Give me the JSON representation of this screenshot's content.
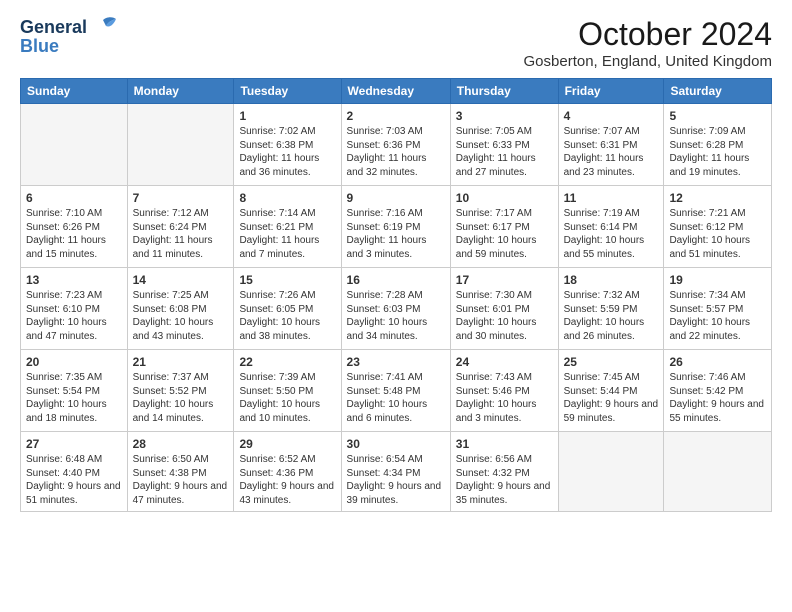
{
  "header": {
    "logo_line1": "General",
    "logo_line2": "Blue",
    "month_title": "October 2024",
    "location": "Gosberton, England, United Kingdom"
  },
  "days_of_week": [
    "Sunday",
    "Monday",
    "Tuesday",
    "Wednesday",
    "Thursday",
    "Friday",
    "Saturday"
  ],
  "weeks": [
    [
      {
        "day": "",
        "info": ""
      },
      {
        "day": "",
        "info": ""
      },
      {
        "day": "1",
        "info": "Sunrise: 7:02 AM\nSunset: 6:38 PM\nDaylight: 11 hours and 36 minutes."
      },
      {
        "day": "2",
        "info": "Sunrise: 7:03 AM\nSunset: 6:36 PM\nDaylight: 11 hours and 32 minutes."
      },
      {
        "day": "3",
        "info": "Sunrise: 7:05 AM\nSunset: 6:33 PM\nDaylight: 11 hours and 27 minutes."
      },
      {
        "day": "4",
        "info": "Sunrise: 7:07 AM\nSunset: 6:31 PM\nDaylight: 11 hours and 23 minutes."
      },
      {
        "day": "5",
        "info": "Sunrise: 7:09 AM\nSunset: 6:28 PM\nDaylight: 11 hours and 19 minutes."
      }
    ],
    [
      {
        "day": "6",
        "info": "Sunrise: 7:10 AM\nSunset: 6:26 PM\nDaylight: 11 hours and 15 minutes."
      },
      {
        "day": "7",
        "info": "Sunrise: 7:12 AM\nSunset: 6:24 PM\nDaylight: 11 hours and 11 minutes."
      },
      {
        "day": "8",
        "info": "Sunrise: 7:14 AM\nSunset: 6:21 PM\nDaylight: 11 hours and 7 minutes."
      },
      {
        "day": "9",
        "info": "Sunrise: 7:16 AM\nSunset: 6:19 PM\nDaylight: 11 hours and 3 minutes."
      },
      {
        "day": "10",
        "info": "Sunrise: 7:17 AM\nSunset: 6:17 PM\nDaylight: 10 hours and 59 minutes."
      },
      {
        "day": "11",
        "info": "Sunrise: 7:19 AM\nSunset: 6:14 PM\nDaylight: 10 hours and 55 minutes."
      },
      {
        "day": "12",
        "info": "Sunrise: 7:21 AM\nSunset: 6:12 PM\nDaylight: 10 hours and 51 minutes."
      }
    ],
    [
      {
        "day": "13",
        "info": "Sunrise: 7:23 AM\nSunset: 6:10 PM\nDaylight: 10 hours and 47 minutes."
      },
      {
        "day": "14",
        "info": "Sunrise: 7:25 AM\nSunset: 6:08 PM\nDaylight: 10 hours and 43 minutes."
      },
      {
        "day": "15",
        "info": "Sunrise: 7:26 AM\nSunset: 6:05 PM\nDaylight: 10 hours and 38 minutes."
      },
      {
        "day": "16",
        "info": "Sunrise: 7:28 AM\nSunset: 6:03 PM\nDaylight: 10 hours and 34 minutes."
      },
      {
        "day": "17",
        "info": "Sunrise: 7:30 AM\nSunset: 6:01 PM\nDaylight: 10 hours and 30 minutes."
      },
      {
        "day": "18",
        "info": "Sunrise: 7:32 AM\nSunset: 5:59 PM\nDaylight: 10 hours and 26 minutes."
      },
      {
        "day": "19",
        "info": "Sunrise: 7:34 AM\nSunset: 5:57 PM\nDaylight: 10 hours and 22 minutes."
      }
    ],
    [
      {
        "day": "20",
        "info": "Sunrise: 7:35 AM\nSunset: 5:54 PM\nDaylight: 10 hours and 18 minutes."
      },
      {
        "day": "21",
        "info": "Sunrise: 7:37 AM\nSunset: 5:52 PM\nDaylight: 10 hours and 14 minutes."
      },
      {
        "day": "22",
        "info": "Sunrise: 7:39 AM\nSunset: 5:50 PM\nDaylight: 10 hours and 10 minutes."
      },
      {
        "day": "23",
        "info": "Sunrise: 7:41 AM\nSunset: 5:48 PM\nDaylight: 10 hours and 6 minutes."
      },
      {
        "day": "24",
        "info": "Sunrise: 7:43 AM\nSunset: 5:46 PM\nDaylight: 10 hours and 3 minutes."
      },
      {
        "day": "25",
        "info": "Sunrise: 7:45 AM\nSunset: 5:44 PM\nDaylight: 9 hours and 59 minutes."
      },
      {
        "day": "26",
        "info": "Sunrise: 7:46 AM\nSunset: 5:42 PM\nDaylight: 9 hours and 55 minutes."
      }
    ],
    [
      {
        "day": "27",
        "info": "Sunrise: 6:48 AM\nSunset: 4:40 PM\nDaylight: 9 hours and 51 minutes."
      },
      {
        "day": "28",
        "info": "Sunrise: 6:50 AM\nSunset: 4:38 PM\nDaylight: 9 hours and 47 minutes."
      },
      {
        "day": "29",
        "info": "Sunrise: 6:52 AM\nSunset: 4:36 PM\nDaylight: 9 hours and 43 minutes."
      },
      {
        "day": "30",
        "info": "Sunrise: 6:54 AM\nSunset: 4:34 PM\nDaylight: 9 hours and 39 minutes."
      },
      {
        "day": "31",
        "info": "Sunrise: 6:56 AM\nSunset: 4:32 PM\nDaylight: 9 hours and 35 minutes."
      },
      {
        "day": "",
        "info": ""
      },
      {
        "day": "",
        "info": ""
      }
    ]
  ]
}
